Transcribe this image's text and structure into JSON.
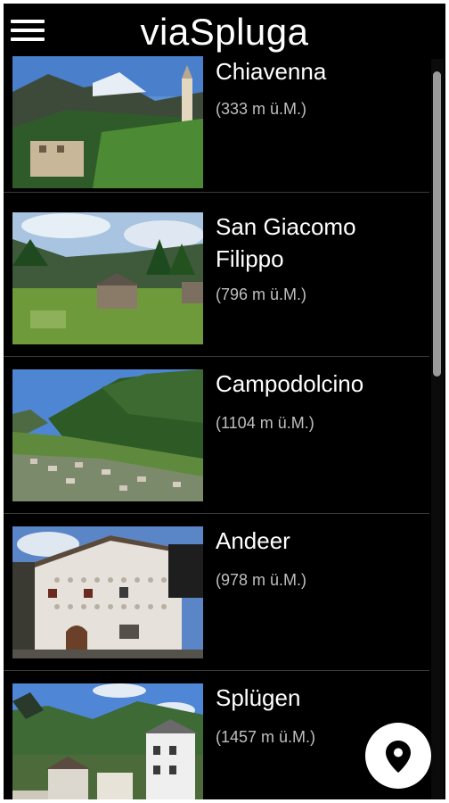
{
  "header": {
    "title": "viaSpluga"
  },
  "places": [
    {
      "name": "Chiavenna",
      "elevation": "(333 m ü.M.)"
    },
    {
      "name": "San Giacomo Filippo",
      "elevation": "(796 m ü.M.)"
    },
    {
      "name": "Campodolcino",
      "elevation": "(1104 m ü.M.)"
    },
    {
      "name": "Andeer",
      "elevation": "(978 m ü.M.)"
    },
    {
      "name": "Splügen",
      "elevation": "(1457 m ü.M.)"
    }
  ],
  "icons": {
    "menu": "hamburger-menu-icon",
    "map": "map-pin-icon"
  },
  "colors": {
    "background": "#000000",
    "text": "#ffffff",
    "secondary_text": "#bfbfbf",
    "fab": "#ffffff"
  }
}
